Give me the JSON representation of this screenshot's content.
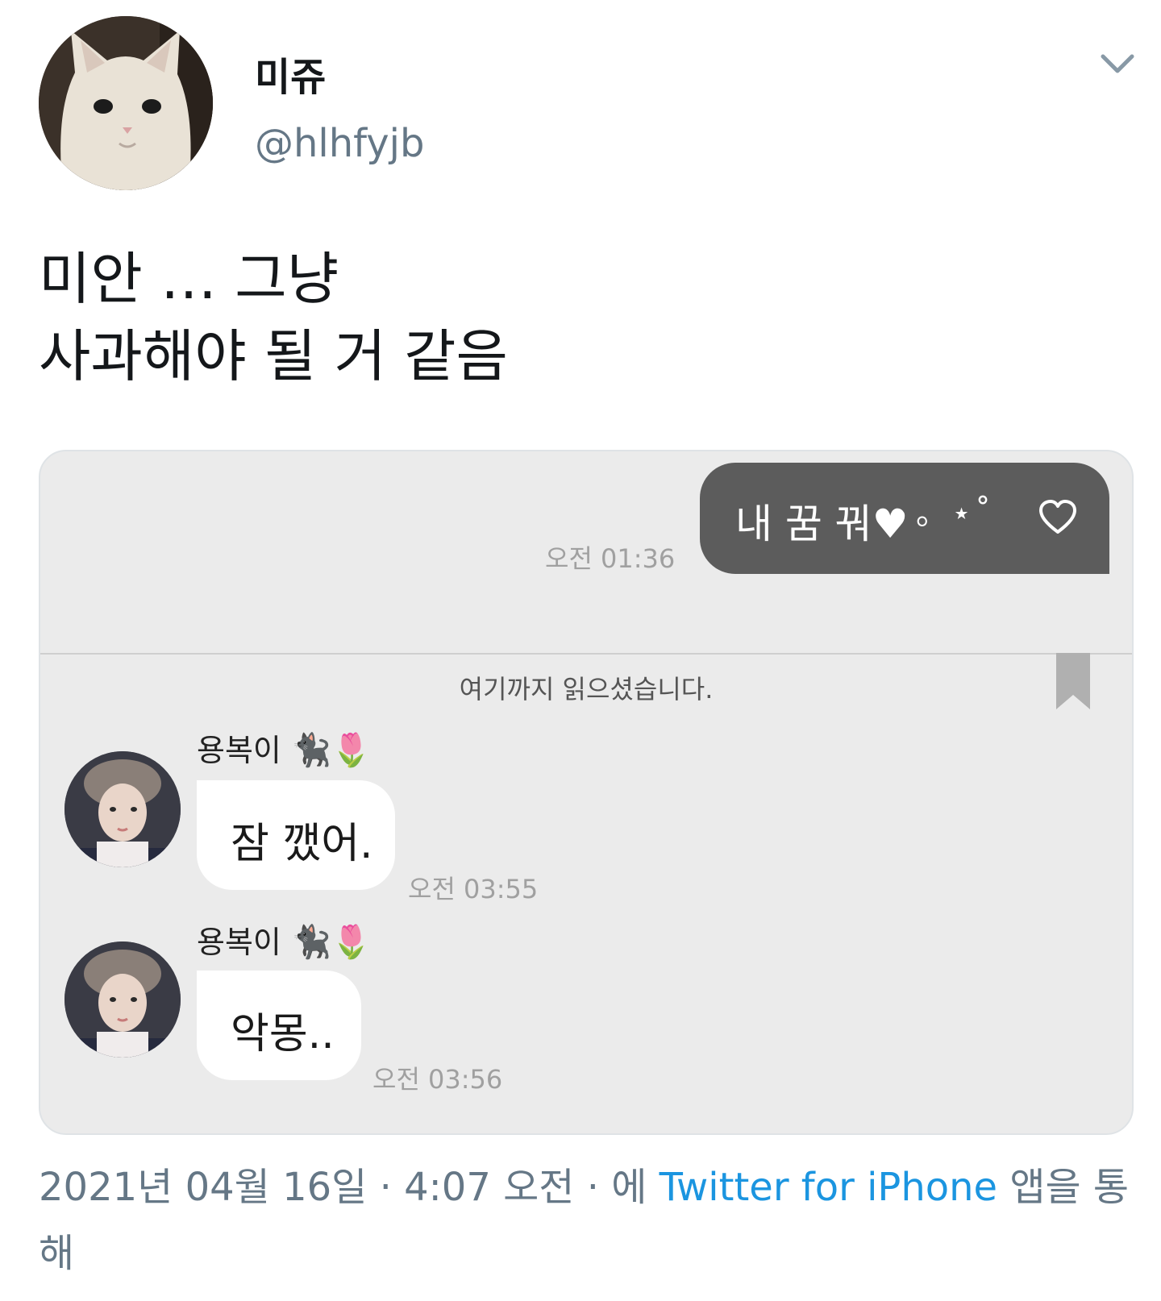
{
  "author": {
    "display_name": "미쥬",
    "handle": "@hlhfyjb",
    "avatar_icon": "cat-photo-avatar",
    "menu_icon": "chevron-down-icon"
  },
  "tweet": {
    "text_line1": "미안 … 그냥",
    "text_line2": "사과해야 될 거 같음"
  },
  "chat": {
    "outgoing": {
      "text": "내 꿈 꿔",
      "decoration": "。⋆˚",
      "heart_icon": "heart-outline-icon",
      "time": "오전 01:36"
    },
    "read_marker": "여기까지 읽으셨습니다.",
    "bookmark_icon": "bookmark-icon",
    "messages": [
      {
        "sender": "용복이",
        "sender_emoji": "🐈‍⬛🌷",
        "text": "잠 깼어.",
        "time": "오전 03:55"
      },
      {
        "sender": "용복이",
        "sender_emoji": "🐈‍⬛🌷",
        "text": "악몽..",
        "time": "오전 03:56"
      }
    ]
  },
  "footer": {
    "date": "2021년 04월 16일",
    "sep1": " · ",
    "time": "4:07 오전",
    "sep2": " · ",
    "via_prefix": "에 ",
    "app": "Twitter for iPhone",
    "via_suffix": " 앱을 통해"
  },
  "colors": {
    "handle": "#657786",
    "link": "#1b95e0",
    "outgoing_bubble": "#5c5c5c",
    "chat_background": "#ebebeb"
  }
}
